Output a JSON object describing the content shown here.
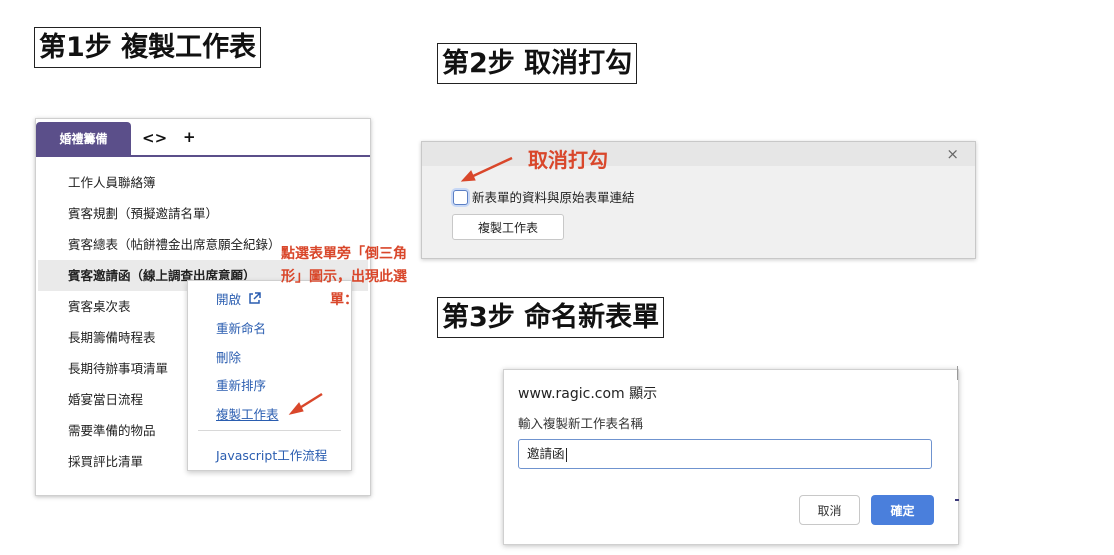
{
  "steps": {
    "step1": "第1步 複製工作表",
    "step2": "第2步 取消打勾",
    "step3": "第3步 命名新表單"
  },
  "panel1": {
    "active_tab": "婚禮籌備",
    "nav_arrows": "<>",
    "add_tab": "+",
    "sheets": [
      "工作人員聯絡簿",
      "賓客規劃（預擬邀請名單）",
      "賓客總表（帖餅禮金出席意願全紀錄）",
      "賓客邀請函（線上調查出席意願）",
      "賓客桌次表",
      "長期籌備時程表",
      "長期待辦事項清單",
      "婚宴當日流程",
      "需要準備的物品",
      "採買評比清單"
    ],
    "context_menu": {
      "open": "開啟",
      "rename": "重新命名",
      "delete": "刪除",
      "reorder": "重新排序",
      "copy": "複製工作表",
      "javascript": "Javascript工作流程"
    },
    "annotation": "點選表單旁「倒三角形」圖示，出現此選單："
  },
  "panel2": {
    "annotation": "取消打勾",
    "checkbox_label": "新表單的資料與原始表單連結",
    "checkbox_checked": false,
    "copy_button": "複製工作表",
    "close": "×"
  },
  "panel3": {
    "title": "www.ragic.com 顯示",
    "message": "輸入複製新工作表名稱",
    "input_value": "邀請函",
    "cancel": "取消",
    "confirm": "確定"
  },
  "colors": {
    "tab": "#5b4f8a",
    "annotation": "#d9472b",
    "link": "#2a5db0",
    "primary_button": "#4a7fdc"
  }
}
